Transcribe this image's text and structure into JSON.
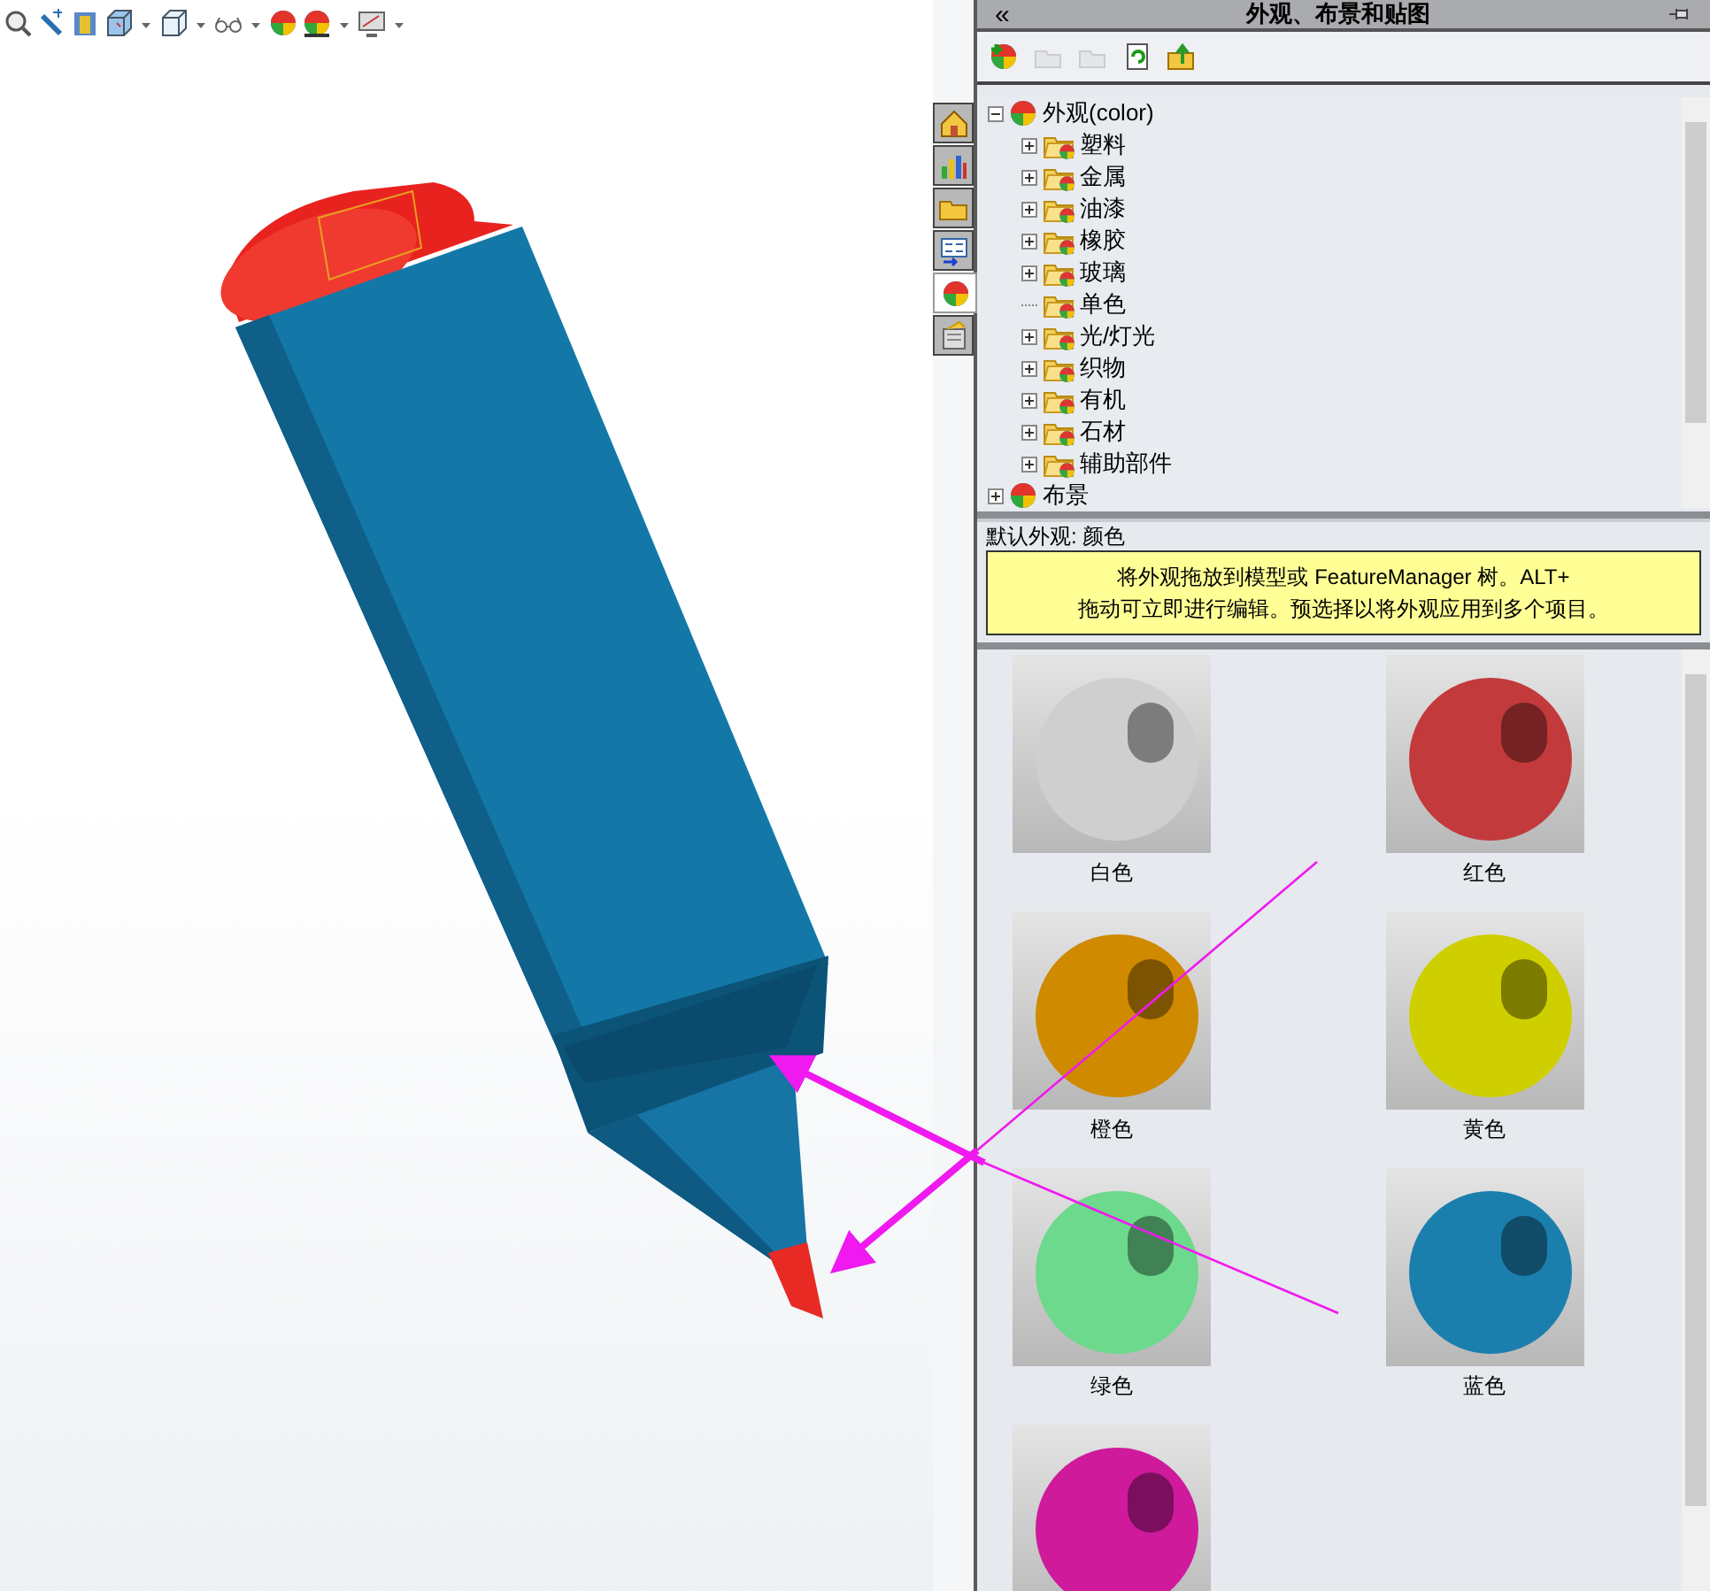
{
  "viewport_toolbar": [
    {
      "has_menu": false
    },
    {
      "has_menu": false
    },
    {
      "has_menu": false
    },
    {
      "has_menu": true
    },
    {
      "has_menu": true
    },
    {
      "has_menu": true
    },
    {
      "has_menu": false
    },
    {
      "has_menu": true
    },
    {
      "has_menu": true
    }
  ],
  "side_tabs": [
    {
      "selected": false
    },
    {
      "selected": false
    },
    {
      "selected": false
    },
    {
      "selected": false
    },
    {
      "selected": true
    },
    {
      "selected": false
    }
  ],
  "panel": {
    "collapse": "«",
    "title": "外观、布景和贴图",
    "toolbar": [
      {
        "disabled": false
      },
      {
        "disabled": true
      },
      {
        "disabled": true
      },
      {
        "disabled": false
      },
      {
        "disabled": false
      }
    ],
    "tree": [
      {
        "label": "外观(color)",
        "expanded": true,
        "children": [
          {
            "label": "塑料",
            "expandable": true
          },
          {
            "label": "金属",
            "expandable": true
          },
          {
            "label": "油漆",
            "expandable": true
          },
          {
            "label": "橡胶",
            "expandable": true
          },
          {
            "label": "玻璃",
            "expandable": true
          },
          {
            "label": "单色",
            "expandable": false
          },
          {
            "label": "光/灯光",
            "expandable": true
          },
          {
            "label": "织物",
            "expandable": true
          },
          {
            "label": "有机",
            "expandable": true
          },
          {
            "label": "石材",
            "expandable": true
          },
          {
            "label": "辅助部件",
            "expandable": true
          }
        ]
      },
      {
        "label": "布景",
        "expanded": false
      }
    ],
    "default_label": "默认外观: 颜色",
    "hint": [
      "将外观拖放到模型或 FeatureManager 树。ALT+",
      "拖动可立即进行编辑。预选择以将外观应用到多个项目。"
    ],
    "swatches": [
      {
        "label": "白色",
        "color": "#cfcfcf"
      },
      {
        "label": "红色",
        "color": "#c23a3c"
      },
      {
        "label": "橙色",
        "color": "#cf8a00"
      },
      {
        "label": "黄色",
        "color": "#cfcf00"
      },
      {
        "label": "绿色",
        "color": "#6dd98c"
      },
      {
        "label": "蓝色",
        "color": "#1b7fae"
      },
      {
        "color": "#cf1a9c"
      }
    ]
  }
}
